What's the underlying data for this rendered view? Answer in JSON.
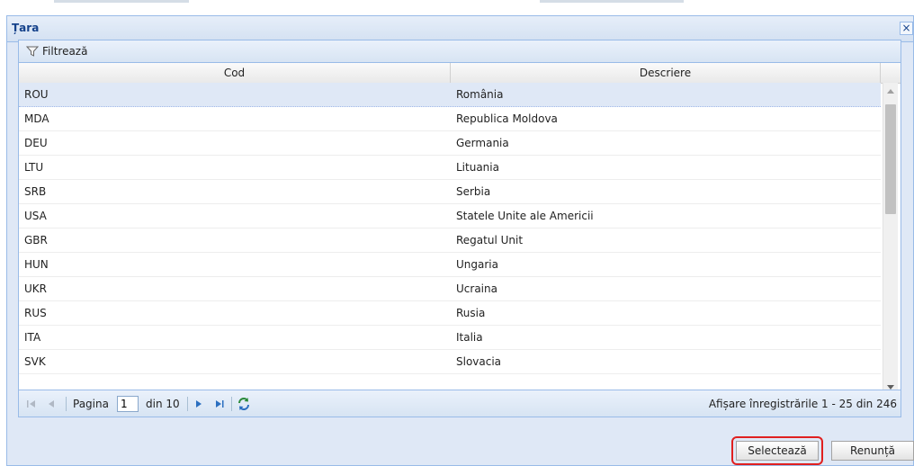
{
  "dialog": {
    "title": "Țara"
  },
  "toolbar": {
    "filter_label": "Filtrează"
  },
  "grid": {
    "columns": [
      "Cod",
      "Descriere"
    ],
    "rows": [
      {
        "code": "ROU",
        "name": "România"
      },
      {
        "code": "MDA",
        "name": "Republica Moldova"
      },
      {
        "code": "DEU",
        "name": "Germania"
      },
      {
        "code": "LTU",
        "name": "Lituania"
      },
      {
        "code": "SRB",
        "name": "Serbia"
      },
      {
        "code": "USA",
        "name": "Statele Unite ale Americii"
      },
      {
        "code": "GBR",
        "name": "Regatul Unit"
      },
      {
        "code": "HUN",
        "name": "Ungaria"
      },
      {
        "code": "UKR",
        "name": "Ucraina"
      },
      {
        "code": "RUS",
        "name": "Rusia"
      },
      {
        "code": "ITA",
        "name": "Italia"
      },
      {
        "code": "SVK",
        "name": "Slovacia"
      }
    ],
    "selected_index": 0
  },
  "pager": {
    "page_label": "Pagina",
    "page_value": "1",
    "of_label": "din 10",
    "status": "Afișare înregistrările 1 - 25 din 246"
  },
  "buttons": {
    "select": "Selectează",
    "cancel": "Renunță"
  }
}
